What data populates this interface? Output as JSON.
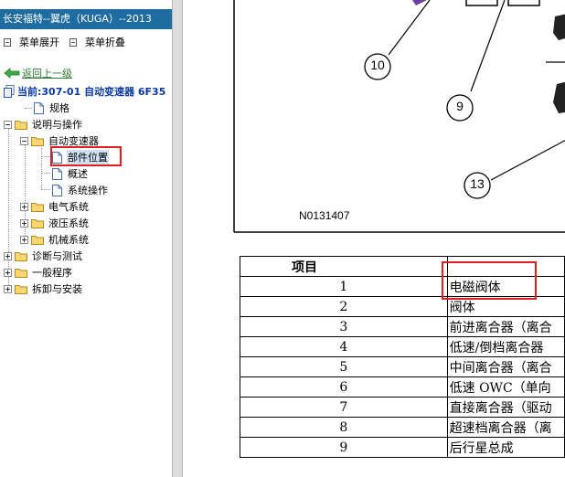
{
  "nav": {
    "title": "长安福特--翼虎（KUGA）--2013",
    "expand_label": "菜单展开",
    "collapse_label": "菜单折叠",
    "back_label": "返回上一级",
    "current_label": "当前:307-01 自动变速器 6F35",
    "tree": {
      "spec": "规格",
      "desc": "说明与操作",
      "auto_trans": "自动变速器",
      "component_location": "部件位置",
      "overview": "概述",
      "system_operation": "系统操作",
      "electrical": "电气系统",
      "hydraulic": "液压系统",
      "mechanical": "机械系统",
      "diagnosis": "诊断与测试",
      "general": "一般程序",
      "removal": "拆卸与安装"
    }
  },
  "figure": {
    "callouts": [
      "10",
      "9",
      "13"
    ],
    "code": "N0131407"
  },
  "table": {
    "header": "项目",
    "rows": [
      {
        "no": "1",
        "desc": "电磁阀体"
      },
      {
        "no": "2",
        "desc": "阀体"
      },
      {
        "no": "3",
        "desc": "前进离合器（离合"
      },
      {
        "no": "4",
        "desc": "低速/倒档离合器"
      },
      {
        "no": "5",
        "desc": "中间离合器（离合"
      },
      {
        "no": "6",
        "desc": "低速 OWC（单向"
      },
      {
        "no": "7",
        "desc": "直接离合器（驱动"
      },
      {
        "no": "8",
        "desc": "超速档离合器（离"
      },
      {
        "no": "9",
        "desc": "后行星总成"
      }
    ]
  },
  "colors": {
    "title_bar": "#1f6da0",
    "highlight": "#e02020",
    "back_link": "#2e7d32",
    "current_text": "#0b3aa4"
  }
}
